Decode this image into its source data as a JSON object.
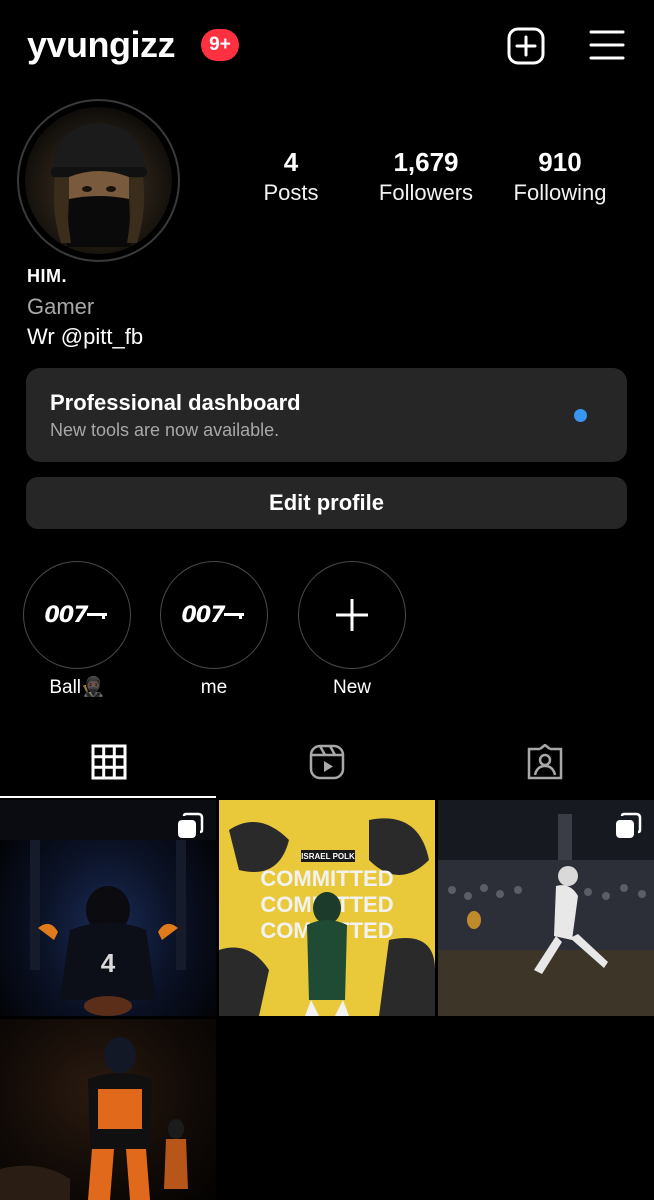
{
  "header": {
    "username": "yvungizz",
    "notification_badge": "9+",
    "new_post_icon": "plus-square-icon",
    "menu_icon": "hamburger-menu-icon"
  },
  "profile": {
    "avatar_icon": "profile-photo",
    "stats": [
      {
        "value": "4",
        "label": "Posts"
      },
      {
        "value": "1,679",
        "label": "Followers"
      },
      {
        "value": "910",
        "label": "Following"
      }
    ],
    "name": "HIM.",
    "category": "Gamer",
    "bio": "Wr @pitt_fb"
  },
  "dashboard": {
    "title": "Professional dashboard",
    "subtitle": "New tools are now available."
  },
  "edit_profile_label": "Edit profile",
  "highlights": [
    {
      "cover_text": "007",
      "label": "Ball🥷🏿"
    },
    {
      "cover_text": "007",
      "label": "me"
    },
    {
      "cover_icon": "plus-icon",
      "label": "New"
    }
  ],
  "tabs": [
    {
      "icon": "grid-icon",
      "active": true
    },
    {
      "icon": "reels-icon",
      "active": false
    },
    {
      "icon": "tagged-icon",
      "active": false
    }
  ],
  "posts": [
    {
      "overlay_text": "4",
      "multi": true
    },
    {
      "overlay_title": "ISRAEL POLK",
      "overlay_text": "COMMITTED",
      "multi": false
    },
    {
      "multi": true
    },
    {
      "multi": false
    }
  ],
  "colors": {
    "background": "#000000",
    "card": "#262626",
    "badge": "#ff3040",
    "accent_dot": "#3797f0",
    "secondary_text": "#a8a8a8"
  }
}
